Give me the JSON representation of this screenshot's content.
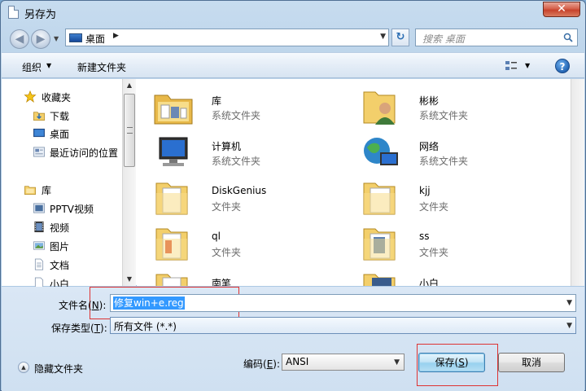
{
  "window": {
    "title": "另存为",
    "close_label": "✕"
  },
  "navigation": {
    "back_label": "◀",
    "forward_label": "▶",
    "recent_label": "▼",
    "address_text": "桌面",
    "address_chevron": "▶",
    "address_dropdown": "▼",
    "refresh_label": "↻",
    "search_placeholder": "搜索 桌面"
  },
  "toolbar": {
    "organize_label": "组织",
    "organize_arrow": "▼",
    "new_folder_label": "新建文件夹",
    "view_arrow": "▼",
    "help_label": "?"
  },
  "nav_pane": {
    "scroll_up": "▲",
    "scroll_down": "▼",
    "items": [
      {
        "label": "收藏夹",
        "icon": "star-icon"
      },
      {
        "label": "下载",
        "icon": "download-folder-icon"
      },
      {
        "label": "桌面",
        "icon": "desktop-icon"
      },
      {
        "label": "最近访问的位置",
        "icon": "recent-places-icon"
      },
      {
        "label": "库",
        "icon": "library-icon"
      },
      {
        "label": "PPTV视频",
        "icon": "video-library-icon"
      },
      {
        "label": "视频",
        "icon": "video-icon"
      },
      {
        "label": "图片",
        "icon": "picture-icon"
      },
      {
        "label": "文档",
        "icon": "document-icon"
      },
      {
        "label": "小白",
        "icon": "music-icon"
      }
    ]
  },
  "files": [
    {
      "name": "库",
      "type": "系统文件夹",
      "icon": "library-folder-icon"
    },
    {
      "name": "彬彬",
      "type": "系统文件夹",
      "icon": "user-folder-icon"
    },
    {
      "name": "计算机",
      "type": "系统文件夹",
      "icon": "computer-icon"
    },
    {
      "name": "网络",
      "type": "系统文件夹",
      "icon": "network-icon"
    },
    {
      "name": "DiskGenius",
      "type": "文件夹",
      "icon": "folder-icon"
    },
    {
      "name": "kjj",
      "type": "文件夹",
      "icon": "folder-icon"
    },
    {
      "name": "ql",
      "type": "文件夹",
      "icon": "folder-icon"
    },
    {
      "name": "ss",
      "type": "文件夹",
      "icon": "folder-icon"
    },
    {
      "name": "南笔",
      "type": "",
      "icon": "folder-icon"
    },
    {
      "name": "小白",
      "type": "",
      "icon": "folder-icon"
    }
  ],
  "form": {
    "filename_label": "文件名(",
    "filename_hotkey": "N",
    "filename_label_end": "):",
    "filename_value": "修复win+e.reg",
    "filename_arrow": "▼",
    "savetype_label": "保存类型(",
    "savetype_hotkey": "T",
    "savetype_label_end": "):",
    "savetype_value": "所有文件  (*.*)",
    "savetype_arrow": "▼",
    "hide_folders_icon": "▲",
    "hide_folders_label": "隐藏文件夹",
    "encoding_label": "编码(",
    "encoding_hotkey": "E",
    "encoding_label_end": "):",
    "encoding_value": "ANSI",
    "encoding_arrow": "▼",
    "save_label": "保存(",
    "save_hotkey": "S",
    "save_label_end": ")",
    "cancel_label": "取消"
  },
  "colors": {
    "highlight": "#3399ff",
    "annotation_red": "#dd3333"
  }
}
